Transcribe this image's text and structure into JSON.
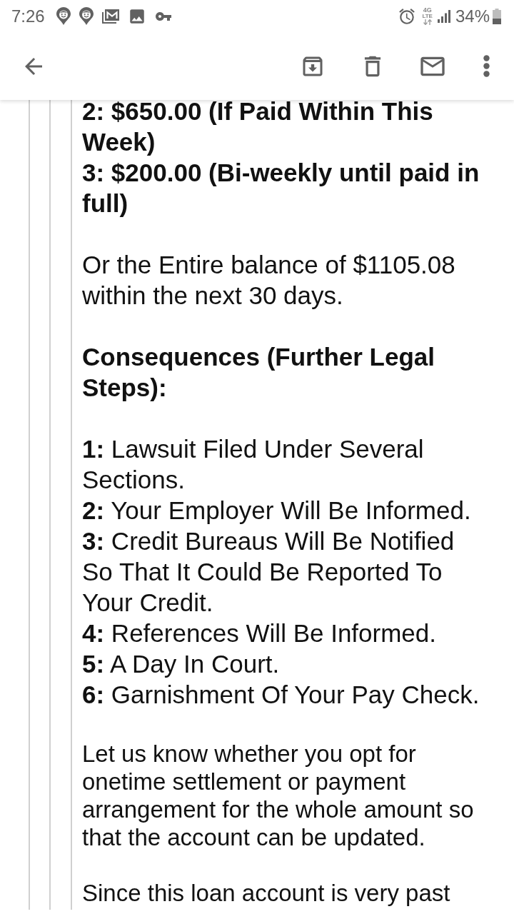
{
  "status_bar": {
    "time": "7:26",
    "network_generation": "4G",
    "network_label": "LTE",
    "battery": "34%"
  },
  "message": {
    "payment_lines": [
      "2: $650.00 (If Paid Within This Week)",
      "3: $200.00 (Bi-weekly until paid in full)"
    ],
    "balance_text": "Or the Entire balance of $1105.08 within the next 30 days.",
    "consequences_heading": "Consequences (Further Legal Steps):",
    "consequences": [
      "**1:** Lawsuit Filed Under Several Sections.",
      "**2:** Your Employer Will Be Informed.",
      "**3:** Credit Bureaus Will Be Notified So That It Could Be Reported To Your Credit.",
      "**4:** References Will Be Informed.",
      "**5:** A Day In Court.",
      "**6:** Garnishment Of Your Pay Check."
    ],
    "closing_paragraphs": [
      "Let us know whether you opt for onetime settlement or payment arrangement for the whole amount so that the account can be updated.",
      "Since this loan account is very past"
    ]
  }
}
